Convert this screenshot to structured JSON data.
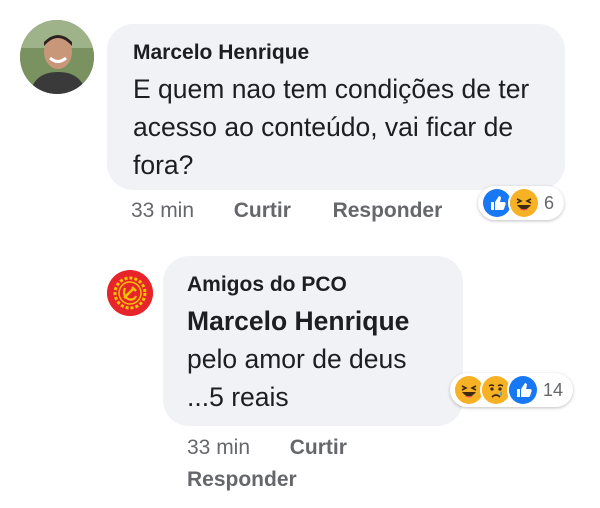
{
  "comment": {
    "author": "Marcelo Henrique",
    "text": "E quem nao tem condições de ter acesso ao conteúdo, vai ficar de fora?",
    "time": "33 min",
    "like_label": "Curtir",
    "reply_label": "Responder",
    "reaction_count": "6",
    "reactions": [
      "like-icon",
      "haha-icon"
    ]
  },
  "reply": {
    "author": "Amigos do PCO",
    "mention": "Marcelo Henrique",
    "text_line1": "pelo amor de deus",
    "text_line2": "...5 reais",
    "time": "33 min",
    "like_label": "Curtir",
    "reply_label": "Responder",
    "reaction_count": "14",
    "reactions": [
      "haha-icon",
      "sad-icon",
      "like-icon"
    ]
  },
  "colors": {
    "like": "#1877f2",
    "emoji": "#f7b125",
    "pco_red": "#e8242b"
  }
}
